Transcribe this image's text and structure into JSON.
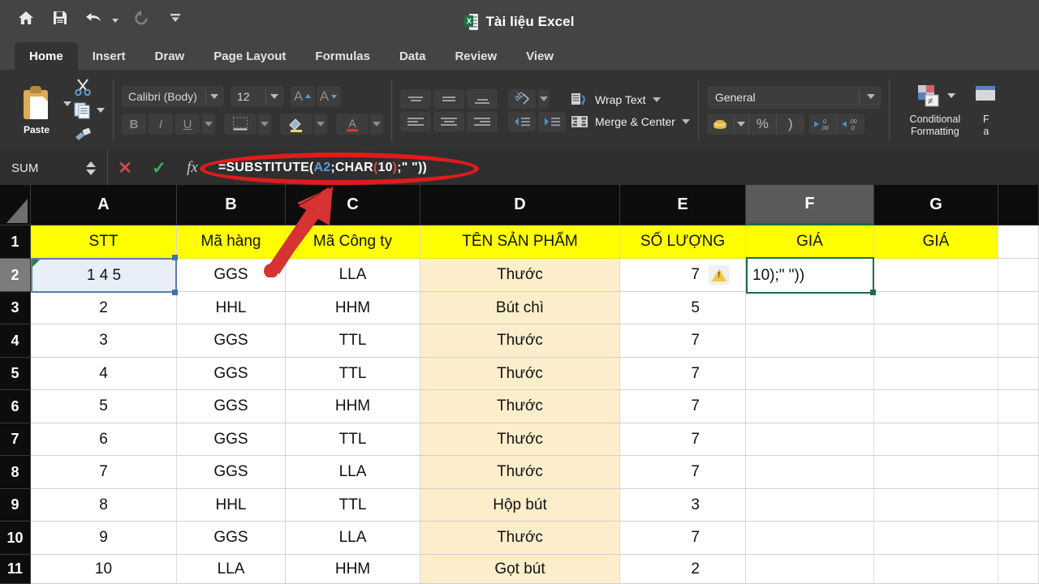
{
  "titlebar": {
    "document_title": "Tài liệu Excel",
    "quick_access": [
      {
        "name": "home-icon",
        "label": "Home"
      },
      {
        "name": "save-icon",
        "label": "Save"
      },
      {
        "name": "undo-icon",
        "label": "Undo"
      },
      {
        "name": "redo-icon",
        "label": "Redo"
      },
      {
        "name": "customize-toolbar-icon",
        "label": "Customize Quick Access Toolbar"
      }
    ]
  },
  "ribbon": {
    "tabs": [
      {
        "label": "Home",
        "active": true
      },
      {
        "label": "Insert",
        "active": false
      },
      {
        "label": "Draw",
        "active": false
      },
      {
        "label": "Page Layout",
        "active": false
      },
      {
        "label": "Formulas",
        "active": false
      },
      {
        "label": "Data",
        "active": false
      },
      {
        "label": "Review",
        "active": false
      },
      {
        "label": "View",
        "active": false
      }
    ],
    "clipboard": {
      "paste_label": "Paste",
      "cut_label": "Cut",
      "copy_label": "Copy",
      "format_painter_label": "Format Painter"
    },
    "font": {
      "family_value": "Calibri (Body)",
      "size_value": "12",
      "grow_label": "A",
      "shrink_label": "A",
      "bold_label": "B",
      "italic_label": "I",
      "underline_label": "U"
    },
    "alignment": {
      "wrap_text_label": "Wrap Text",
      "merge_center_label": "Merge & Center"
    },
    "number": {
      "format_value": "General",
      "percent_label": "%",
      "comma_label": ")",
      "increase_decimal_label": ".00",
      "decrease_decimal_label": ".0"
    },
    "styles": {
      "conditional_formatting_label_line1": "Conditional",
      "conditional_formatting_label_line2": "Formatting",
      "format_as_table_label_line1": "F",
      "format_as_table_label_line2": "a"
    }
  },
  "formula_bar": {
    "name_box_value": "SUM",
    "cancel_label": "✕",
    "enter_label": "✓",
    "fx_label": "fx",
    "formula_tokens": [
      {
        "text": "=SUBSTITUTE(",
        "color": "white"
      },
      {
        "text": "A2",
        "color": "blue"
      },
      {
        "text": ";CHAR",
        "color": "white"
      },
      {
        "text": "(",
        "color": "red"
      },
      {
        "text": "10",
        "color": "white"
      },
      {
        "text": ")",
        "color": "red"
      },
      {
        "text": ";\" \"))",
        "color": "white"
      }
    ],
    "formula_plain": "=SUBSTITUTE(A2;CHAR(10);\" \"))"
  },
  "sheet": {
    "column_headers": [
      "A",
      "B",
      "C",
      "D",
      "E",
      "F",
      "G"
    ],
    "selected_column": "F",
    "row_headers": [
      "1",
      "2",
      "3",
      "4",
      "5",
      "6",
      "7",
      "8",
      "9",
      "10",
      "11"
    ],
    "selected_row": "2",
    "header_row": {
      "A": "STT",
      "B": "Mã hàng",
      "C": "Mã Công ty",
      "D": "TÊN SẢN PHẨM",
      "E": "SỐ LƯỢNG",
      "F": "GIÁ",
      "G": "GIÁ"
    },
    "rows": [
      {
        "row": "2",
        "A": "1 4 5",
        "B": "GGS",
        "C": "LLA",
        "D": "Thước",
        "E": "7",
        "F": "10);\" \"))",
        "G": ""
      },
      {
        "row": "3",
        "A": "2",
        "B": "HHL",
        "C": "HHM",
        "D": "Bút chì",
        "E": "5",
        "F": "",
        "G": ""
      },
      {
        "row": "4",
        "A": "3",
        "B": "GGS",
        "C": "TTL",
        "D": "Thước",
        "E": "7",
        "F": "",
        "G": ""
      },
      {
        "row": "5",
        "A": "4",
        "B": "GGS",
        "C": "TTL",
        "D": "Thước",
        "E": "7",
        "F": "",
        "G": ""
      },
      {
        "row": "6",
        "A": "5",
        "B": "GGS",
        "C": "HHM",
        "D": "Thước",
        "E": "7",
        "F": "",
        "G": ""
      },
      {
        "row": "7",
        "A": "6",
        "B": "GGS",
        "C": "TTL",
        "D": "Thước",
        "E": "7",
        "F": "",
        "G": ""
      },
      {
        "row": "8",
        "A": "7",
        "B": "GGS",
        "C": "LLA",
        "D": "Thước",
        "E": "7",
        "F": "",
        "G": ""
      },
      {
        "row": "9",
        "A": "8",
        "B": "HHL",
        "C": "TTL",
        "D": "Hộp bút",
        "E": "3",
        "F": "",
        "G": ""
      },
      {
        "row": "10",
        "A": "9",
        "B": "GGS",
        "C": "LLA",
        "D": "Thước",
        "E": "7",
        "F": "",
        "G": ""
      },
      {
        "row": "11",
        "A": "10",
        "B": "LLA",
        "C": "HHM",
        "D": "Gọt bút",
        "E": "2",
        "F": "",
        "G": ""
      }
    ],
    "active_cell_a2": "1 4 5",
    "editing_cell_f2": "10);\" \"))",
    "error_indicator_cell": "E2"
  },
  "annotations": {
    "ellipse_target": "formula-bar-input",
    "arrow_target": "column-c-header",
    "color": "#e01b1b"
  },
  "colors": {
    "header_yellow": "#ffff00",
    "beige_column": "#fdeecb",
    "ribbon_dark": "#333333",
    "titlebar_dark": "#444444",
    "grid_header_black": "#0d0d0d",
    "selection_green": "#1d6b4a",
    "selection_blue": "#5b7ea6",
    "annotation_red": "#e01b1b"
  }
}
